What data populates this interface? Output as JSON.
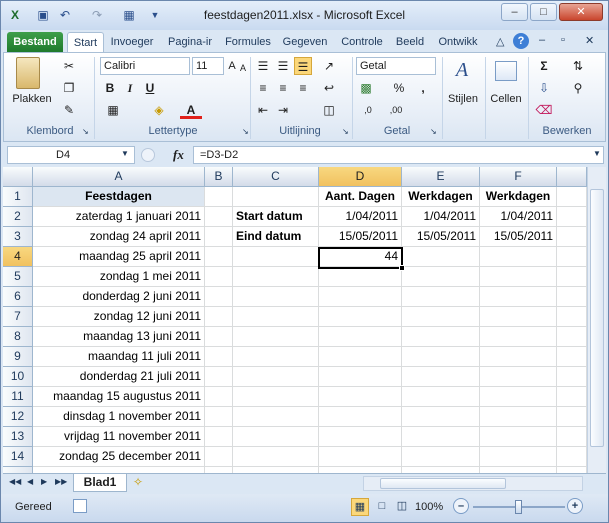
{
  "window": {
    "title": "feestdagen2011.xlsx - Microsoft Excel",
    "minimize": "–",
    "restore": "□",
    "close": "✕"
  },
  "tabs": [
    "Bestand",
    "Start",
    "Invoeger",
    "Pagina-ir",
    "Formules",
    "Gegeven",
    "Controle",
    "Beeld",
    "Ontwikk"
  ],
  "ribbon": {
    "paste_label": "Plakken",
    "font_name": "Calibri",
    "font_size": "11",
    "number_format": "Getal",
    "styles_label": "Stijlen",
    "cells_label": "Cellen",
    "groups": [
      "Klembord",
      "Lettertype",
      "Uitlijning",
      "Getal",
      "Bewerken"
    ]
  },
  "formula_bar": {
    "name_box": "D4",
    "fx": "fx",
    "formula": "=D3-D2"
  },
  "grid": {
    "columns": [
      "A",
      "B",
      "C",
      "D",
      "E",
      "F"
    ],
    "selected_column": "D",
    "rows": [
      "1",
      "2",
      "3",
      "4",
      "5",
      "6",
      "7",
      "8",
      "9",
      "10",
      "11",
      "12",
      "13",
      "14"
    ],
    "selected_row": "4",
    "A": [
      "Feestdagen",
      "zaterdag 1 januari 2011",
      "zondag 24 april 2011",
      "maandag 25 april 2011",
      "zondag 1 mei 2011",
      "donderdag 2 juni 2011",
      "zondag 12 juni 2011",
      "maandag 13 juni 2011",
      "maandag 11 juli 2011",
      "donderdag 21 juli 2011",
      "maandag 15 augustus 2011",
      "dinsdag 1 november 2011",
      "vrijdag 11 november 2011",
      "zondag 25 december 2011"
    ],
    "C2": "Start datum",
    "C3": "Eind datum",
    "D1": "Aant. Dagen",
    "E1": "Werkdagen",
    "F1": "Werkdagen",
    "D2": "1/04/2011",
    "E2": "1/04/2011",
    "F2": "1/04/2011",
    "D3": "15/05/2011",
    "E3": "15/05/2011",
    "F3": "15/05/2011",
    "D4": "44"
  },
  "sheet_tab": "Blad1",
  "status": {
    "ready": "Gereed",
    "zoom": "100%"
  },
  "colors": {
    "file_tab": "#2a8a38",
    "selection_border": "#000000",
    "header_highlight": "#f4c86c"
  }
}
